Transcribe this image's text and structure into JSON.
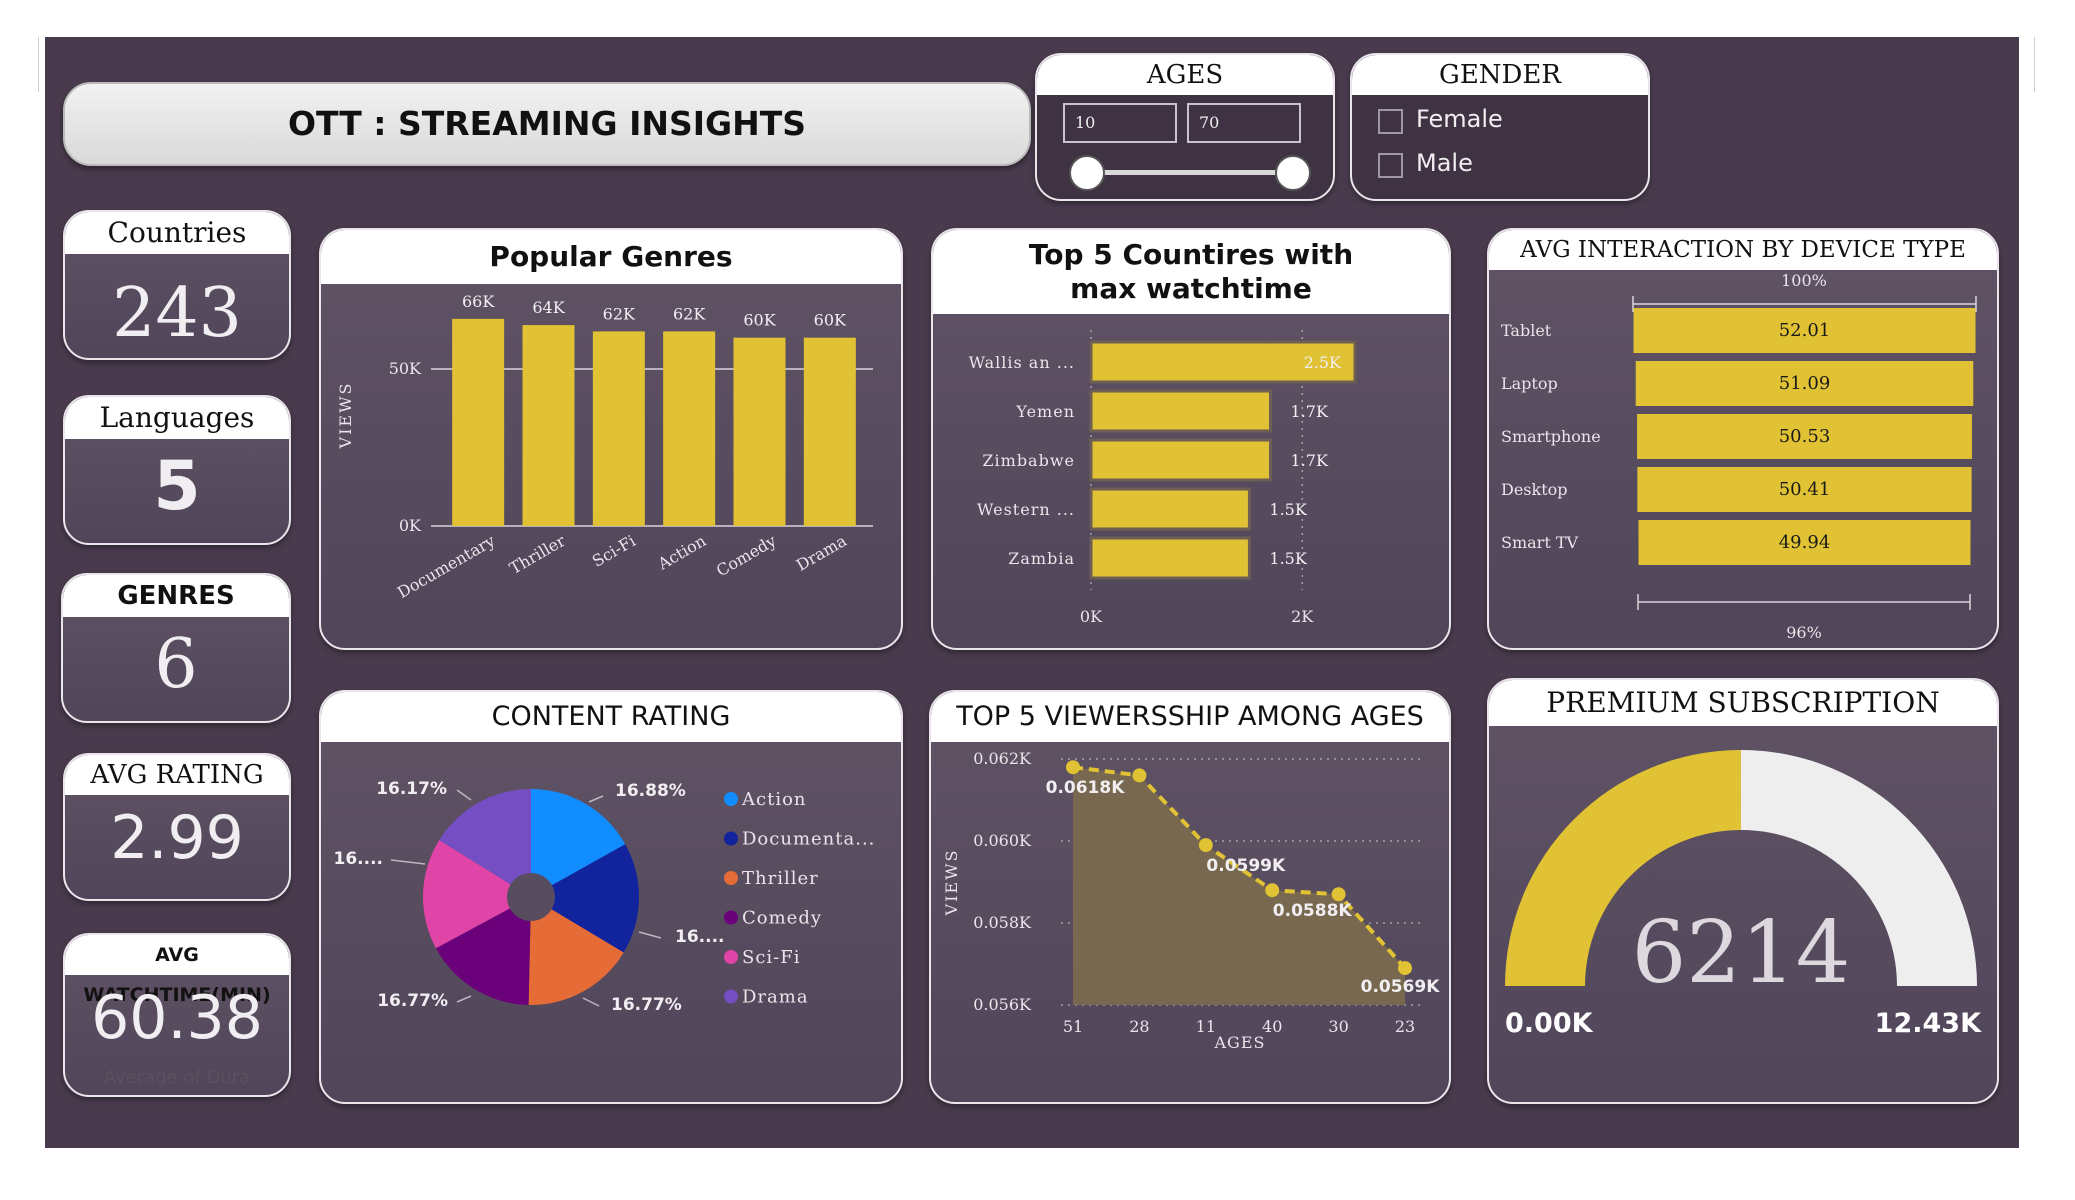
{
  "title": "OTT : STREAMING INSIGHTS",
  "ages_filter": {
    "title": "AGES",
    "min": "10",
    "max": "70"
  },
  "gender_filter": {
    "title": "GENDER",
    "options": [
      "Female",
      "Male"
    ]
  },
  "kpis": {
    "countries": {
      "label": "Countries",
      "value": "243"
    },
    "languages": {
      "label": "Languages",
      "value": "5"
    },
    "genres": {
      "label": "GENRES",
      "value": "6"
    },
    "avg_rating": {
      "label": "AVG RATING",
      "value": "2.99"
    },
    "avg_watchtime": {
      "label": "AVG WATCHTIME(MIN)",
      "value": "60.38",
      "caption": "Average of Dura"
    }
  },
  "colors": {
    "background": "#493b4d",
    "accent": "#e0c234",
    "panel_border": "#e9e5ea"
  },
  "chart_data": [
    {
      "id": "popular_genres",
      "type": "bar",
      "title": "Popular Genres",
      "categories": [
        "Documentary",
        "Thriller",
        "Sci-Fi",
        "Action",
        "Comedy",
        "Drama"
      ],
      "values": [
        66,
        64,
        62,
        62,
        60,
        60
      ],
      "data_labels": [
        "66K",
        "64K",
        "62K",
        "62K",
        "60K",
        "60K"
      ],
      "ylabel": "VIEWS",
      "yticks": [
        "0K",
        "50K"
      ],
      "ylim": [
        0,
        72
      ],
      "grid": true
    },
    {
      "id": "top_countries",
      "type": "bar",
      "orientation": "horizontal",
      "title": "Top 5 Countires with max watchtime",
      "categories": [
        "Wallis an ...",
        "Yemen",
        "Zimbabwe",
        "Western ...",
        "Zambia"
      ],
      "values": [
        2.5,
        1.7,
        1.7,
        1.5,
        1.5
      ],
      "data_labels": [
        "2.5K",
        "1.7K",
        "1.7K",
        "1.5K",
        "1.5K"
      ],
      "xticks": [
        "0K",
        "2K"
      ],
      "xlim": [
        0,
        2.5
      ]
    },
    {
      "id": "device_interaction",
      "type": "bar",
      "orientation": "horizontal",
      "title": "AVG INTERACTION BY DEVICE TYPE",
      "categories": [
        "Tablet",
        "Laptop",
        "Smartphone",
        "Desktop",
        "Smart TV"
      ],
      "values": [
        52.01,
        51.09,
        50.53,
        50.41,
        49.94
      ],
      "data_labels": [
        "52.01",
        "51.09",
        "50.53",
        "50.41",
        "49.94"
      ],
      "top_scale_label": "100%",
      "bottom_scale_label": "96%"
    },
    {
      "id": "content_rating",
      "type": "pie",
      "title": "CONTENT RATING",
      "labels": [
        "Action",
        "Documenta...",
        "Thriller",
        "Comedy",
        "Sci-Fi",
        "Drama"
      ],
      "values": [
        16.88,
        16.7,
        16.77,
        16.77,
        16.7,
        16.17
      ],
      "slice_labels": [
        "16.88%",
        "16....",
        "16.77%",
        "16.77%",
        "16....",
        "16.17%"
      ],
      "colors": [
        "#118dff",
        "#12239e",
        "#e66c37",
        "#6b007b",
        "#e044a7",
        "#744ec2"
      ],
      "legend": "right"
    },
    {
      "id": "viewership_ages",
      "type": "area",
      "title": "TOP 5 VIEWERSSHIP AMONG AGES",
      "x": [
        "51",
        "28",
        "11",
        "40",
        "30",
        "23"
      ],
      "values": [
        0.0618,
        0.0616,
        0.0599,
        0.0588,
        0.0587,
        0.0569
      ],
      "data_labels": [
        "0.0618K",
        "",
        "0.0599K",
        "0.0588K",
        "",
        "0.0569K"
      ],
      "xlabel": "AGES",
      "ylabel": "VIEWS",
      "yticks": [
        "0.056K",
        "0.058K",
        "0.060K",
        "0.062K"
      ],
      "ylim": [
        0.056,
        0.062
      ]
    },
    {
      "id": "premium_subscription",
      "type": "gauge",
      "title": "PREMIUM SUBSCRIPTION",
      "value": 6214,
      "value_label": "6214",
      "min_label": "0.00K",
      "max_label": "12.43K",
      "min": 0,
      "max": 12430
    }
  ]
}
